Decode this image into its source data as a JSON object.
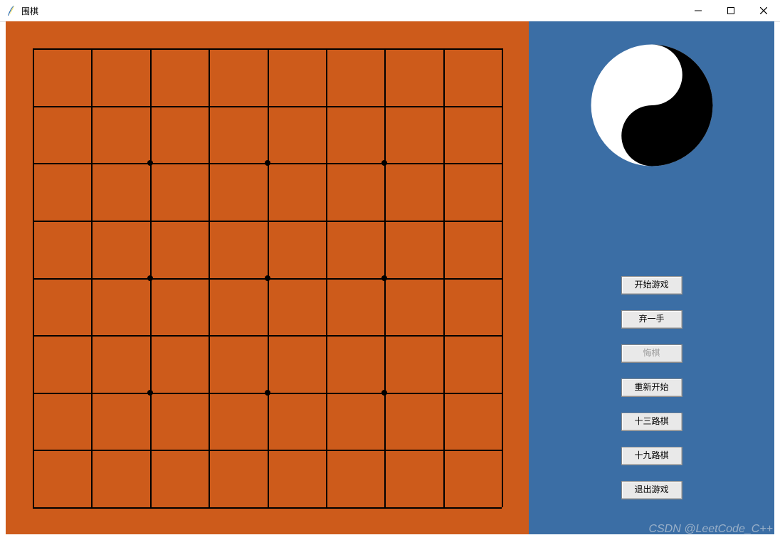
{
  "window": {
    "title": "围棋"
  },
  "board": {
    "size": 9,
    "color": "#cd5b1b",
    "line_color": "#000000",
    "star_points": [
      [
        2,
        2
      ],
      [
        4,
        2
      ],
      [
        6,
        2
      ],
      [
        2,
        4
      ],
      [
        4,
        4
      ],
      [
        6,
        4
      ],
      [
        2,
        6
      ],
      [
        4,
        6
      ],
      [
        6,
        6
      ]
    ]
  },
  "side": {
    "bg": "#3b6ea5"
  },
  "buttons": {
    "start": {
      "label": "开始游戏",
      "enabled": true
    },
    "pass": {
      "label": "弃一手",
      "enabled": true
    },
    "undo": {
      "label": "悔棋",
      "enabled": false
    },
    "restart": {
      "label": "重新开始",
      "enabled": true
    },
    "size13": {
      "label": "十三路棋",
      "enabled": true
    },
    "size19": {
      "label": "十九路棋",
      "enabled": true
    },
    "quit": {
      "label": "退出游戏",
      "enabled": true
    }
  },
  "watermark": "CSDN @LeetCode_C++"
}
